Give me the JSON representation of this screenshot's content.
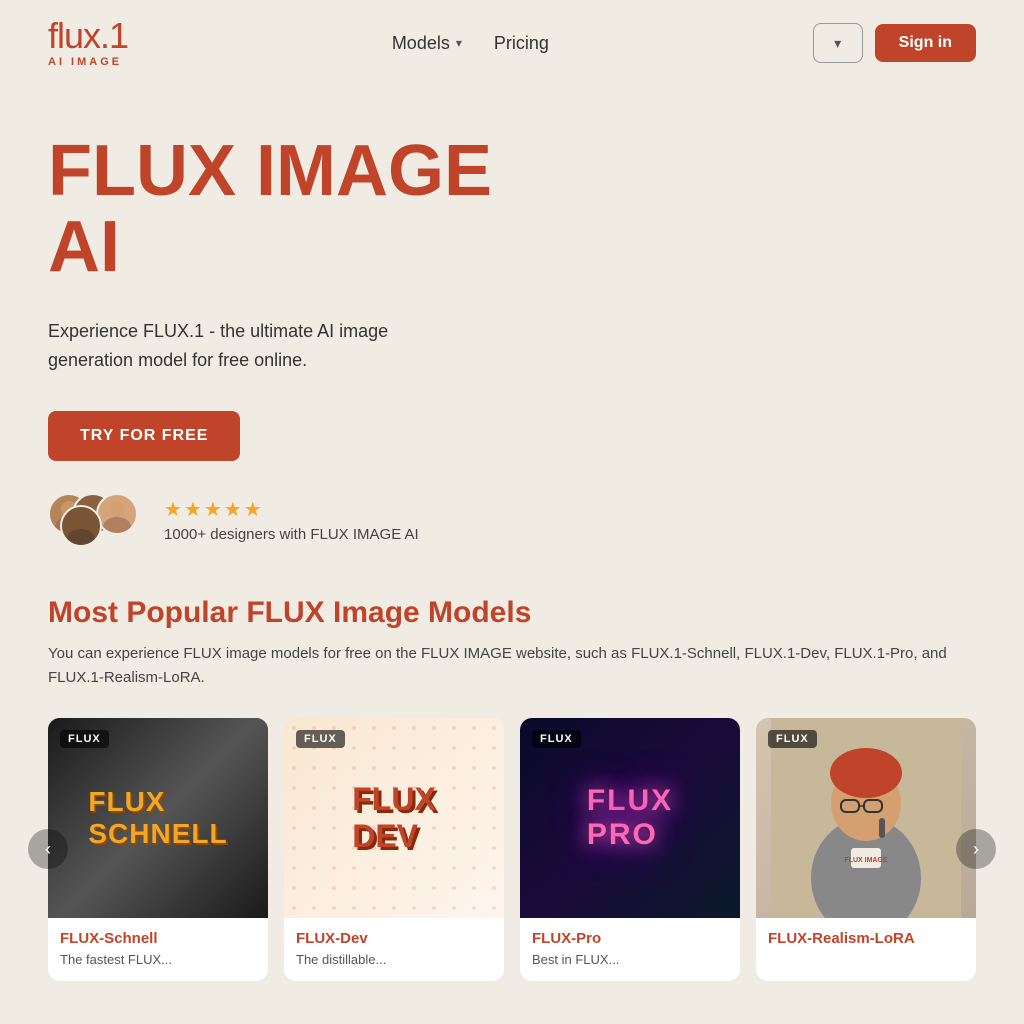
{
  "header": {
    "logo_main": "flux.1",
    "logo_subtitle": "AI IMAGE",
    "nav_models": "Models",
    "nav_pricing": "Pricing",
    "lang_btn_icon": "▾",
    "signin_label": "Sign in"
  },
  "hero": {
    "title_line1": "FLUX IMAGE",
    "title_line2": "AI",
    "subtitle": "Experience FLUX.1 - the ultimate AI image generation model for free online.",
    "cta_label": "TRY FOR FREE",
    "social_proof_text": "1000+ designers with FLUX IMAGE AI",
    "stars_count": "5"
  },
  "models_section": {
    "title": "Most Popular FLUX Image Models",
    "description": "You can experience FLUX image models for free on the FLUX IMAGE website, such as FLUX.1-Schnell, FLUX.1-Dev, FLUX.1-Pro, and FLUX.1-Realism-LoRA.",
    "cards": [
      {
        "badge": "FLUX",
        "title": "FLUX-Schnell",
        "description": "The fastest FLUX...",
        "img_text": "FLUX\nSCHNELL"
      },
      {
        "badge": "FLUX",
        "title": "FLUX-Dev",
        "description": "The distillable...",
        "img_text": "FLUX\nDEV"
      },
      {
        "badge": "FLUX",
        "title": "FLUX-Pro",
        "description": "Best in FLUX...",
        "img_text": "FLUX\nPRO"
      },
      {
        "badge": "FLUX",
        "title": "FLUX-Realism-LoRA",
        "description": "",
        "img_text": "FLUX\nIMAGE"
      }
    ],
    "arrow_left": "‹",
    "arrow_right": "›"
  }
}
